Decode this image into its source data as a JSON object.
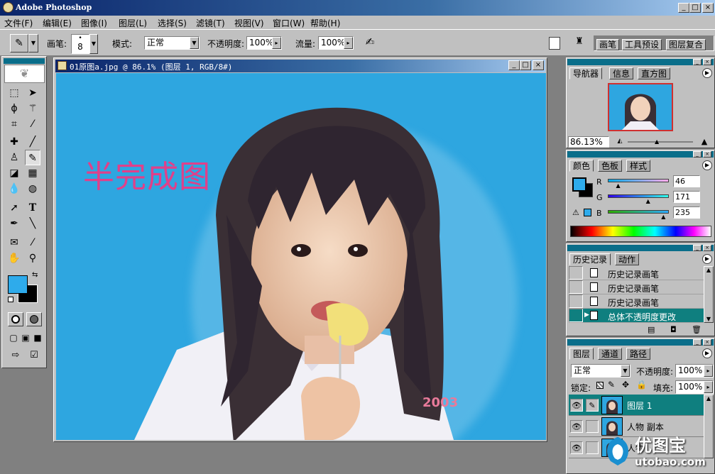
{
  "app": {
    "title": "Adobe Photoshop"
  },
  "menu": [
    "文件(F)",
    "编辑(E)",
    "图像(I)",
    "图层(L)",
    "选择(S)",
    "滤镜(T)",
    "视图(V)",
    "窗口(W)",
    "帮助(H)"
  ],
  "options": {
    "brush_label": "画笔:",
    "brush_size": "8",
    "mode_label": "模式:",
    "mode_value": "正常",
    "opacity_label": "不透明度:",
    "opacity_value": "100%",
    "flow_label": "流量:",
    "flow_value": "100%",
    "palette_tabs": [
      "画笔",
      "工具预设",
      "图层复合"
    ]
  },
  "document": {
    "title": "01原图a.jpg @ 86.1% (图层 1, RGB/8#)",
    "overlay_text": "半完成图",
    "watermark": "2003"
  },
  "navigator": {
    "tabs": [
      "导航器",
      "信息",
      "直方图"
    ],
    "zoom": "86.13%"
  },
  "color": {
    "tabs": [
      "颜色",
      "色板",
      "样式"
    ],
    "r_label": "R",
    "g_label": "G",
    "b_label": "B",
    "r": "46",
    "g": "171",
    "b": "235",
    "r_level": 46,
    "g_level": 171,
    "b_level": 235,
    "foreground": "#2eabeb",
    "background": "#000000"
  },
  "history": {
    "tabs": [
      "历史记录",
      "动作"
    ],
    "items": [
      "历史记录画笔",
      "历史记录画笔",
      "历史记录画笔",
      "总体不透明度更改"
    ]
  },
  "layers": {
    "tabs": [
      "图层",
      "通道",
      "路径"
    ],
    "blend_mode": "正常",
    "opacity_label": "不透明度:",
    "opacity_value": "100%",
    "lock_label": "锁定:",
    "fill_label": "填充:",
    "fill_value": "100%",
    "items": [
      "图层 1",
      "人物 副本",
      "人物"
    ]
  },
  "logo": {
    "name": "优图宝",
    "url": "utobao.com"
  }
}
